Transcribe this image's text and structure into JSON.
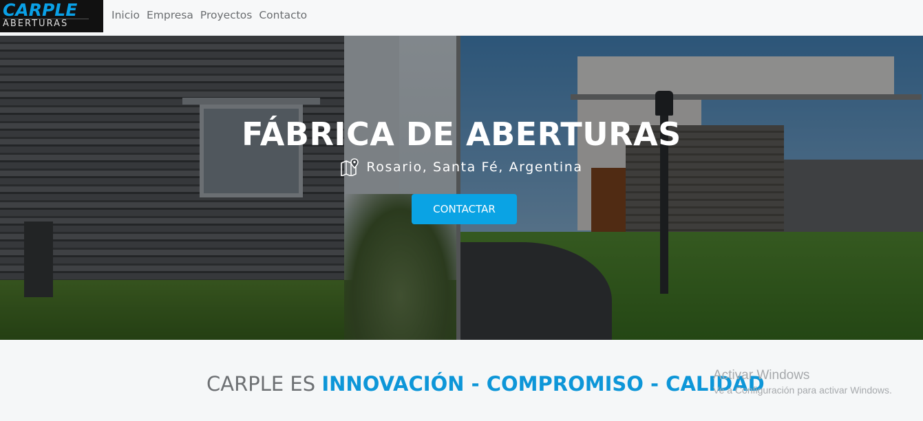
{
  "brand": {
    "logo_top": "CARPLE",
    "logo_bottom": "ABERTURAS",
    "accent": "#0aa3e4"
  },
  "nav": {
    "items": [
      "Inicio",
      "Empresa",
      "Proyectos",
      "Contacto"
    ]
  },
  "hero": {
    "title": "FÁBRICA DE ABERTURAS",
    "location_icon": "map-icon",
    "location": "Rosario, Santa Fé, Argentina",
    "cta_label": "CONTACTAR"
  },
  "tagline": {
    "prefix": "CARPLE ES ",
    "highlight": "INNOVACIÓN - COMPROMISO - CALIDAD"
  },
  "watermark": {
    "title": "Activar Windows",
    "subtitle": "Ve a Configuración para activar Windows."
  }
}
